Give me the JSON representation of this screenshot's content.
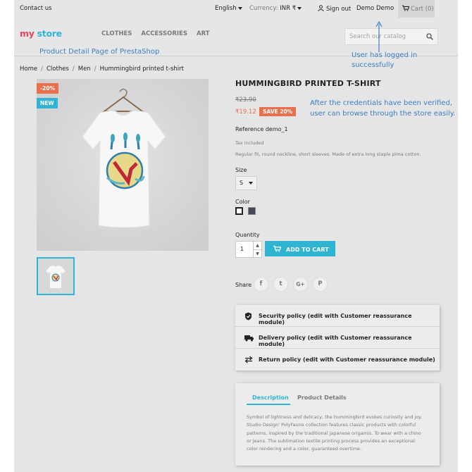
{
  "topbar": {
    "contact": "Contact us",
    "language": "English",
    "currency_label": "Currency:",
    "currency_value": "INR ₹",
    "signout": "Sign out",
    "user": "Demo Demo",
    "cart": "Cart (0)"
  },
  "header": {
    "logo_my": "my",
    "logo_store": "store",
    "nav": [
      "CLOTHES",
      "ACCESSORIES",
      "ART"
    ],
    "search_placeholder": "Search our catalog"
  },
  "annotations": {
    "page_note": "Product Detail Page of PrestaShop",
    "login_note_1": "User has logged in",
    "login_note_2": "successfully",
    "verify_note_1": "After the credentials have been verified,",
    "verify_note_2": "user can browse through the store easily."
  },
  "breadcrumb": [
    "Home",
    "Clothes",
    "Men",
    "Hummingbird printed t-shirt"
  ],
  "product": {
    "discount_flag": "-20%",
    "new_flag": "NEW",
    "title": "HUMMINGBIRD PRINTED T-SHIRT",
    "old_price": "₹23.90",
    "price": "₹19.12",
    "save_badge": "SAVE 20%",
    "reference": "Reference demo_1",
    "tax": "Tax included",
    "short_desc": "Regular fit, round neckline, short sleeves. Made of extra long staple pima cotton.",
    "size_label": "Size",
    "size_value": "S",
    "color_label": "Color",
    "colors": [
      "#ffffff",
      "#434a54"
    ],
    "quantity_label": "Quantity",
    "quantity_value": "1",
    "add_to_cart": "ADD TO CART",
    "share_label": "Share",
    "social": [
      "f",
      "t",
      "G+",
      "P"
    ]
  },
  "reassurance": [
    {
      "icon": "shield-check-icon",
      "label": "Security policy (edit with Customer reassurance module)"
    },
    {
      "icon": "truck-icon",
      "label": "Delivery policy (edit with Customer reassurance module)"
    },
    {
      "icon": "swap-arrows-icon",
      "label": "Return policy (edit with Customer reassurance module)"
    }
  ],
  "tabs": {
    "description": "Description",
    "details": "Product Details",
    "text": [
      "Symbol of lightness and delicacy, the hummingbird evokes curiosity and joy.",
      "Studio Design' PolyFaune collection features classic products with colorful",
      "patterns, inspired by the traditional japanese origamis. To wear with a chino",
      "or jeans. The sublimation textile printing process provides an exceptional",
      "color rendering and a color, guaranteed overtime."
    ]
  },
  "colors": {
    "accent": "#2fb5d2",
    "discount": "#e8704d",
    "annotation": "#3b7fc4"
  }
}
